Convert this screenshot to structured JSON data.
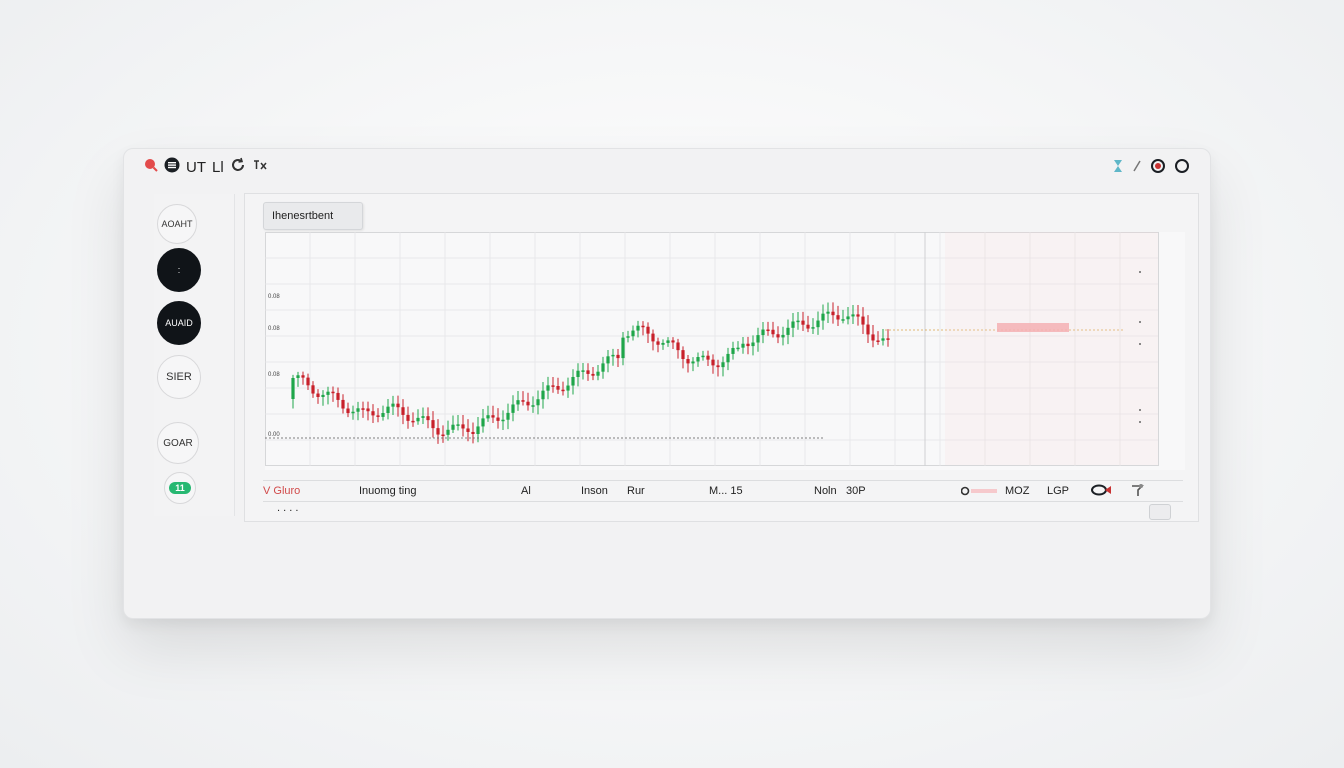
{
  "titlebar": {
    "left_icons": [
      "record-icon",
      "menu-icon"
    ],
    "left_labels": [
      "UT",
      "Ll"
    ],
    "right_icons": [
      "hourglass-icon",
      "circle-icon",
      "circle-icon"
    ]
  },
  "sidebar": {
    "buttons": [
      {
        "label": "AOAHT",
        "style": "light"
      },
      {
        "label": ":",
        "style": "dark"
      },
      {
        "label": "AUAID",
        "style": "dark"
      },
      {
        "label": "SIER",
        "style": "light"
      },
      {
        "label": "GOAR",
        "style": "light"
      },
      {
        "label": "11",
        "style": "green"
      }
    ]
  },
  "panel": {
    "tab_label": "Ihenesrtbent"
  },
  "chart_data": {
    "type": "candlestick",
    "y_tick_labels": [
      "0.08",
      "0.08",
      "0.08",
      "0.00"
    ],
    "colors": {
      "up": "#1fa64a",
      "down": "#c8202a",
      "highlight": "#f4a8ad"
    },
    "grid": true
  },
  "legend": {
    "items": [
      "V Gluro",
      "Inuomg ting",
      "Al",
      "Inson",
      "Rur",
      "M... 15",
      "Noln",
      "30P",
      "MOZ",
      "LGP"
    ]
  },
  "footer": {
    "dots": ". . . ."
  }
}
